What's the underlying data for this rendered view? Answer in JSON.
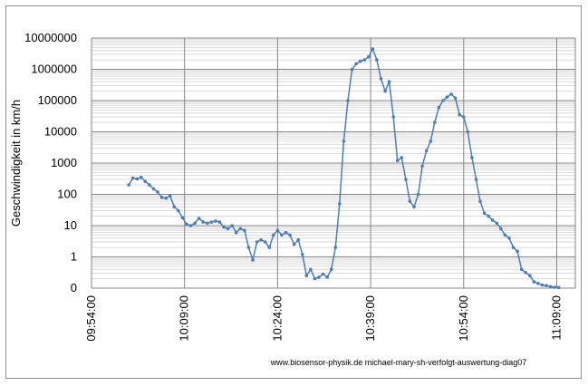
{
  "chart_data": {
    "type": "line",
    "title": "",
    "ylabel": "Geschwindigkeit in km/h",
    "xlabel": "",
    "y_scale": "log",
    "ylim": [
      0,
      10000000
    ],
    "y_ticks": [
      "10000000",
      "1000000",
      "100000",
      "10000",
      "1000",
      "100",
      "10",
      "1",
      "0"
    ],
    "x_ticks": [
      "09:54:00",
      "10:09:00",
      "10:24:00",
      "10:39:00",
      "10:54:00",
      "11:09:00"
    ],
    "xlim": [
      "09:54:00",
      "11:12:00"
    ],
    "grid": true,
    "series_color": "#4a7ebb",
    "credit": "www.biosensor-physik.de  michael-mary-sh-verfolgt-auswertung-diag07",
    "series": [
      {
        "x": [
          "10:00:00",
          "10:00:40",
          "10:01:20",
          "10:02:00",
          "10:02:40",
          "10:03:20",
          "10:04:00",
          "10:04:40",
          "10:05:20",
          "10:06:00",
          "10:06:40",
          "10:07:20",
          "10:08:00",
          "10:08:40",
          "10:09:20",
          "10:10:00",
          "10:10:40",
          "10:11:20",
          "10:12:00",
          "10:12:40",
          "10:13:20",
          "10:14:00",
          "10:14:40",
          "10:15:20",
          "10:16:00",
          "10:16:40",
          "10:17:20",
          "10:18:00",
          "10:18:40",
          "10:19:20",
          "10:20:00",
          "10:20:40",
          "10:21:20",
          "10:22:00",
          "10:22:40",
          "10:23:20",
          "10:24:00",
          "10:24:40",
          "10:25:20",
          "10:26:00",
          "10:26:40",
          "10:27:20",
          "10:28:00",
          "10:28:40",
          "10:29:20",
          "10:30:00",
          "10:30:40",
          "10:31:20",
          "10:32:00",
          "10:32:40",
          "10:33:20",
          "10:34:00",
          "10:34:40",
          "10:35:20",
          "10:36:00",
          "10:36:40",
          "10:37:20",
          "10:38:00",
          "10:38:40",
          "10:39:20",
          "10:40:00",
          "10:40:40",
          "10:41:20",
          "10:42:00",
          "10:42:40",
          "10:43:20",
          "10:44:00",
          "10:44:40",
          "10:45:20",
          "10:46:00",
          "10:46:40",
          "10:47:20",
          "10:48:00",
          "10:48:40",
          "10:49:20",
          "10:50:00",
          "10:50:40",
          "10:51:20",
          "10:52:00",
          "10:52:40",
          "10:53:20",
          "10:54:00",
          "10:54:40",
          "10:55:20",
          "10:56:00",
          "10:56:40",
          "10:57:20",
          "10:58:00",
          "10:58:40",
          "10:59:20",
          "11:00:00",
          "11:00:40",
          "11:01:20",
          "11:02:00",
          "11:02:40",
          "11:03:20",
          "11:04:00",
          "11:04:40",
          "11:05:20",
          "11:06:00",
          "11:06:40",
          "11:07:20",
          "11:08:00",
          "11:08:40",
          "11:09:20"
        ],
        "y": [
          200,
          330,
          310,
          350,
          260,
          200,
          150,
          120,
          80,
          75,
          90,
          40,
          30,
          18,
          11,
          10,
          12,
          17,
          13,
          12,
          13,
          14,
          13,
          9,
          8,
          10,
          6,
          8,
          7,
          2,
          0.9,
          3,
          3.5,
          3,
          2,
          5,
          7,
          5,
          6,
          5,
          2.5,
          3.5,
          1.2,
          0.4,
          0.6,
          0.3,
          0.35,
          0.45,
          0.35,
          0.6,
          2,
          50,
          5000,
          100000,
          1000000,
          1500000,
          1800000,
          2000000,
          2500000,
          4500000,
          2000000,
          500000,
          200000,
          400000,
          30000,
          1200,
          1500,
          300,
          60,
          40,
          100,
          800,
          2500,
          5000,
          20000,
          60000,
          100000,
          130000,
          160000,
          120000,
          35000,
          30000,
          10000,
          1500,
          300,
          60,
          25,
          20,
          15,
          12,
          8,
          5,
          4,
          2,
          1.5,
          0.6,
          0.5,
          0.4,
          0.2,
          0.15,
          0.1,
          0.08,
          0.05,
          0.03,
          0.02
        ]
      }
    ]
  }
}
